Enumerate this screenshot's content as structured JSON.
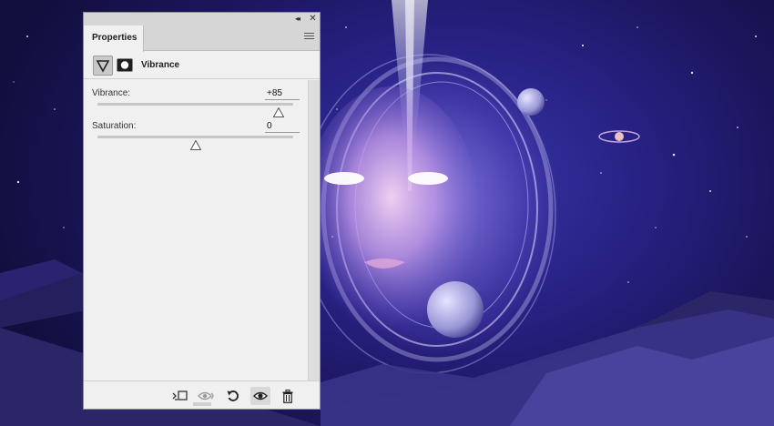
{
  "panel": {
    "tab_label": "Properties",
    "title": "Vibrance",
    "collapse_glyph": "◂◂",
    "close_glyph": "✕"
  },
  "fields": {
    "vibrance": {
      "label": "Vibrance:",
      "value": "+85",
      "percent": 92.5
    },
    "saturation": {
      "label": "Saturation:",
      "value": "0",
      "percent": 50
    }
  },
  "icons": {
    "adjustment": "vibrance-triangle-icon",
    "mask": "layer-mask-icon",
    "clip": "clip-to-layer-icon",
    "view_previous": "view-previous-state-icon",
    "reset": "reset-icon",
    "visibility": "eye-icon",
    "delete": "trash-icon"
  },
  "colors": {
    "panel_bg": "#f0f0f0",
    "tab_bar": "#d6d6d6",
    "canvas_deep": "#1b165c",
    "canvas_glow": "#b8a8ff"
  }
}
